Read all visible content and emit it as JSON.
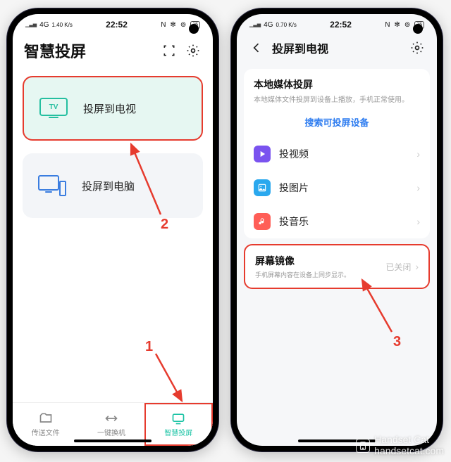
{
  "status": {
    "signal": "4G",
    "speed_left": "1.40 K/s",
    "speed_right": "0.70 K/s",
    "time": "22:52",
    "nfc": "N",
    "bt": "✻",
    "wifi": "⊚",
    "battery": "15"
  },
  "left": {
    "title": "智慧投屏",
    "card_tv": "投屏到电视",
    "card_tv_badge": "TV",
    "card_pc": "投屏到电脑",
    "tabs": {
      "files": "传送文件",
      "switch": "一键换机",
      "cast": "智慧投屏"
    }
  },
  "right": {
    "title": "投屏到电视",
    "media_title": "本地媒体投屏",
    "media_sub": "本地媒体文件投屏到设备上播放，手机正常使用。",
    "search": "搜索可投屏设备",
    "items": {
      "video": "投视频",
      "image": "投图片",
      "music": "投音乐"
    },
    "mirror_title": "屏幕镜像",
    "mirror_sub": "手机屏幕内容在设备上同步显示。",
    "mirror_state": "已关闭"
  },
  "annotations": {
    "n1": "1",
    "n2": "2",
    "n3": "3"
  },
  "watermark": "Handset Cat\nhandsetcat.com"
}
